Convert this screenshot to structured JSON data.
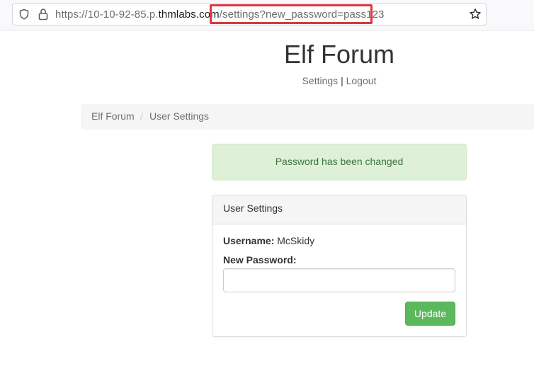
{
  "browser": {
    "url_prefix": "https://10-10-92-85.p.",
    "url_domain": "thmlabs.com",
    "url_path": "/settings?new_password=pass123",
    "highlight_color": "#d9393e"
  },
  "site": {
    "title": "Elf Forum",
    "nav": {
      "settings": "Settings",
      "separator": "|",
      "logout": "Logout"
    }
  },
  "breadcrumb": {
    "home": "Elf Forum",
    "separator": "/",
    "current": "User Settings"
  },
  "alert": {
    "message": "Password has been changed",
    "bg_color": "#dff0d8",
    "text_color": "#3c763d"
  },
  "panel": {
    "heading": "User Settings",
    "username_label": "Username:",
    "username_value": "McSkidy",
    "password_label": "New Password:",
    "password_value": "",
    "submit_label": "Update",
    "submit_color": "#5cb85c"
  },
  "icons": {
    "tracking": "shield-icon",
    "secure": "lock-icon",
    "bookmark": "star-icon"
  }
}
